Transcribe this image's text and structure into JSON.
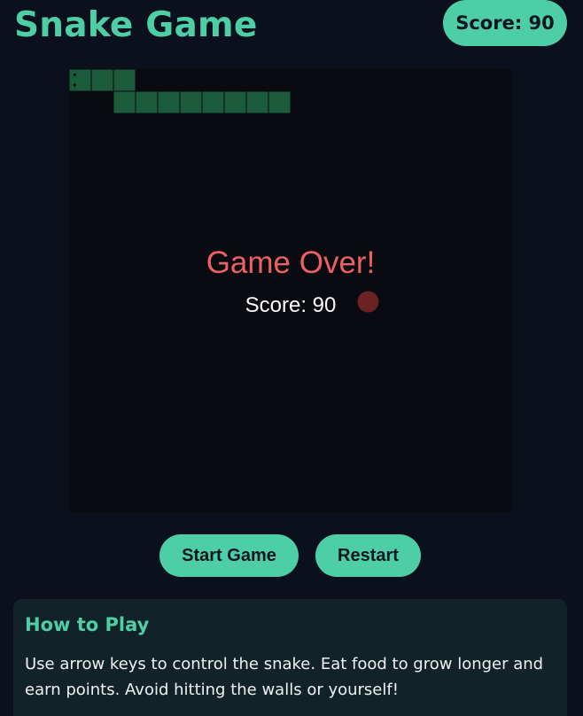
{
  "header": {
    "title": "Snake Game",
    "score_label": "Score: 90"
  },
  "game": {
    "grid_cells": 20,
    "snake_color": "#1c5a3c",
    "food_color": "#6b2225",
    "snake_segments": [
      [
        0,
        0
      ],
      [
        1,
        0
      ],
      [
        2,
        0
      ],
      [
        2,
        1
      ],
      [
        3,
        1
      ],
      [
        4,
        1
      ],
      [
        5,
        1
      ],
      [
        6,
        1
      ],
      [
        7,
        1
      ],
      [
        8,
        1
      ],
      [
        9,
        1
      ]
    ],
    "food": [
      13,
      10
    ],
    "game_over_text": "Game Over!",
    "final_score_text": "Score: 90",
    "game_over_color": "#ec5f63"
  },
  "controls": {
    "start_label": "Start Game",
    "restart_label": "Restart"
  },
  "instructions": {
    "heading": "How to Play",
    "body": "Use arrow keys to control the snake. Eat food to grow longer and earn points. Avoid hitting the walls or yourself!"
  },
  "colors": {
    "accent": "#4ecea6",
    "background": "#0b111c",
    "board": "#090b10",
    "panel": "#112228"
  }
}
